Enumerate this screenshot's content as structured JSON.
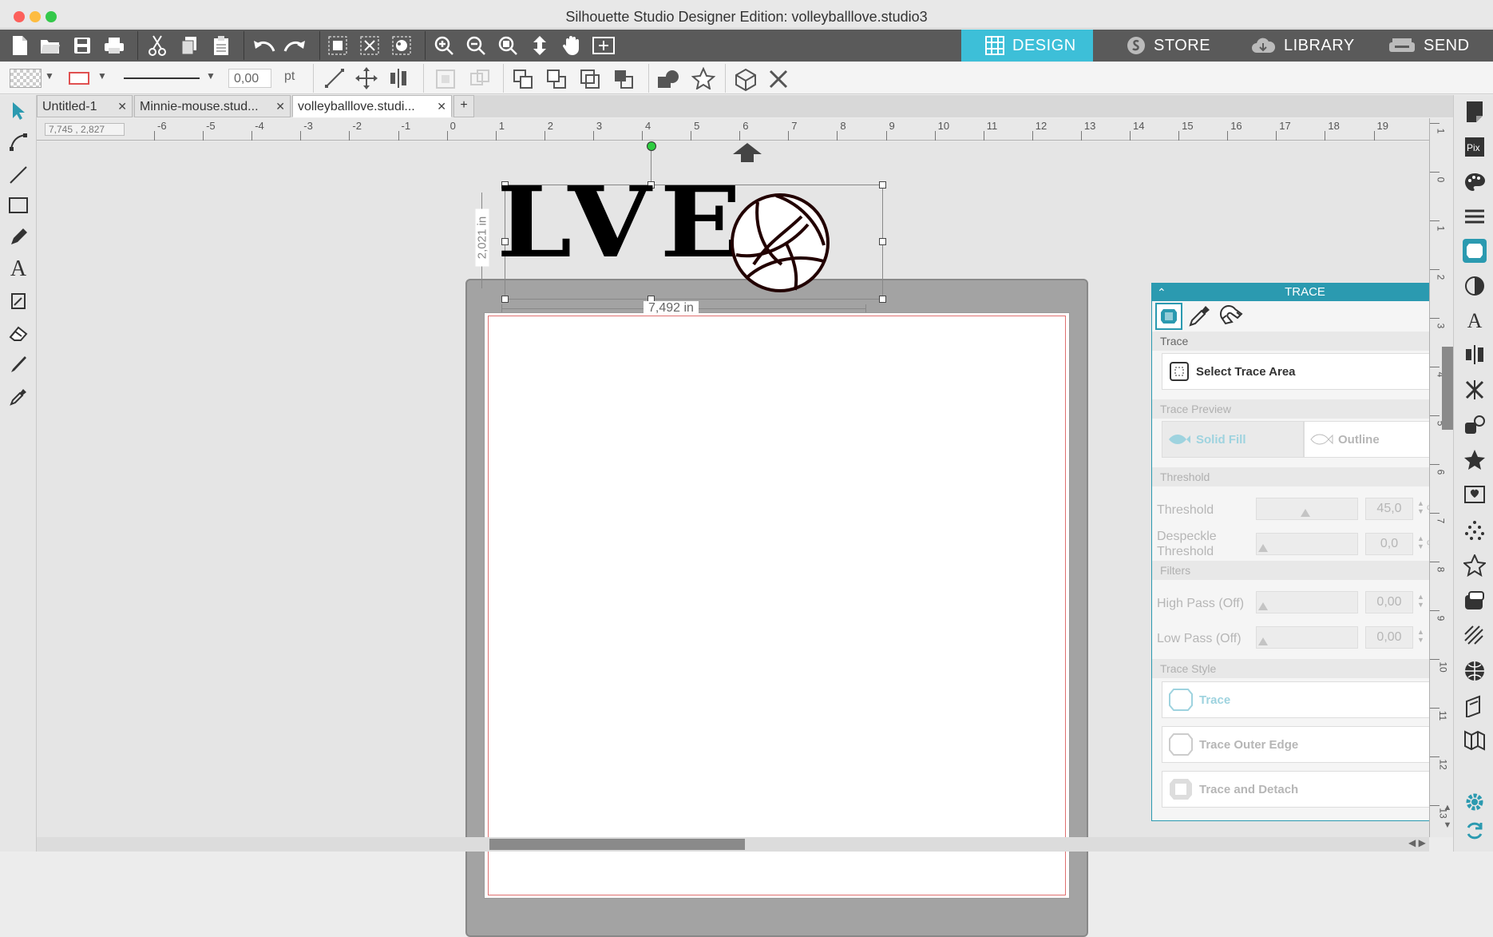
{
  "window": {
    "title": "Silhouette Studio Designer Edition: volleyballlove.studio3"
  },
  "modes": [
    {
      "label": "DESIGN",
      "active": true
    },
    {
      "label": "STORE"
    },
    {
      "label": "LIBRARY"
    },
    {
      "label": "SEND"
    }
  ],
  "toolbar2": {
    "line_width": "0,00",
    "unit": "pt"
  },
  "tabs": [
    {
      "label": "Untitled-1"
    },
    {
      "label": "Minnie-mouse.stud..."
    },
    {
      "label": "volleyballlove.studi..."
    }
  ],
  "tabs_add": "+",
  "coords": "7,745 , 2,827",
  "ruler": {
    "h_ticks": [
      "-6",
      "-5",
      "-4",
      "-3",
      "-2",
      "-1",
      "0",
      "1",
      "2",
      "3",
      "4",
      "5",
      "6",
      "7",
      "8",
      "9",
      "10",
      "11",
      "12",
      "13",
      "14",
      "15",
      "16",
      "17",
      "18",
      "19"
    ],
    "v_ticks": [
      "1",
      "0",
      "1",
      "2",
      "3",
      "4",
      "5",
      "6",
      "7",
      "8",
      "9",
      "10",
      "11",
      "12",
      "13"
    ]
  },
  "design": {
    "text": "LVE",
    "width_label": "7,492 in",
    "height_label": "2,021 in"
  },
  "trace_panel": {
    "title": "TRACE",
    "sections": {
      "trace": "Trace",
      "preview": "Trace Preview",
      "threshold": "Threshold",
      "filters": "Filters",
      "style": "Trace Style"
    },
    "select_trace_area": "Select Trace Area",
    "preview_options": [
      "Solid Fill",
      "Outline"
    ],
    "threshold": {
      "label": "Threshold",
      "value": "45,0",
      "unit": "%"
    },
    "despeckle": {
      "label_line1": "Despeckle",
      "label_line2": "Threshold",
      "value": "0,0",
      "unit": "%"
    },
    "high_pass": {
      "label": "High Pass (Off)",
      "value": "0,00"
    },
    "low_pass": {
      "label": "Low Pass (Off)",
      "value": "0,00"
    },
    "style_buttons": [
      "Trace",
      "Trace Outer Edge",
      "Trace and Detach"
    ]
  },
  "colors": {
    "accent": "#2b9ab0",
    "mode_active": "#3dbfd8",
    "cut_line": "#e07070"
  }
}
